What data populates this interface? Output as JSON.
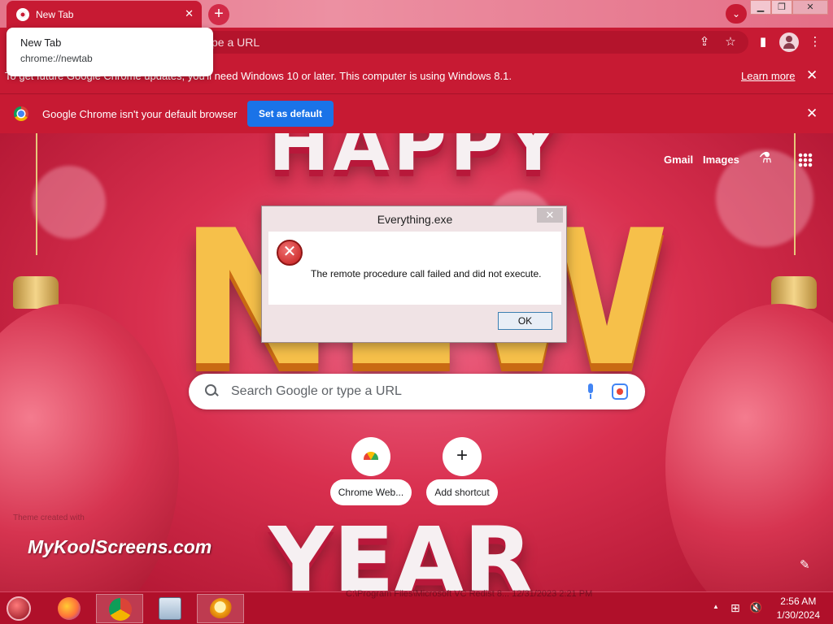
{
  "browser": {
    "tab": {
      "title": "New Tab",
      "close_glyph": "✕"
    },
    "new_tab_glyph": "+",
    "tab_search_glyph": "⌄",
    "window_buttons": {
      "minimize": "▁",
      "restore": "❐",
      "close": "✕"
    },
    "hover_card": {
      "title": "New Tab",
      "url": "chrome://newtab"
    },
    "omnibox": {
      "placeholder": "pe a URL"
    },
    "toolbar_icons": {
      "share": "⇪",
      "bookmark": "☆",
      "side_panel": "▮",
      "menu": "⋮"
    }
  },
  "infobars": {
    "update": {
      "message": "To get future Google Chrome updates, you'll need Windows 10 or later. This computer is using Windows 8.1.",
      "link": "Learn more",
      "close": "✕"
    },
    "default_browser": {
      "message": "Google Chrome isn't your default browser",
      "button": "Set as default",
      "close": "✕"
    }
  },
  "ntp": {
    "links": {
      "gmail": "Gmail",
      "images": "Images"
    },
    "search": {
      "placeholder": "Search Google or type a URL"
    },
    "shortcuts": [
      {
        "label": "Chrome Web...",
        "icon": "chrome-web-store-icon"
      },
      {
        "label": "Add shortcut",
        "icon": "plus-icon",
        "glyph": "+"
      }
    ],
    "edit_glyph": "✎",
    "background_faint_text": "Theme created with",
    "background_letters": {
      "top": "HAPPY",
      "middle": "NEW",
      "bottom": "YEAR"
    }
  },
  "dialog": {
    "title": "Everything.exe",
    "close_glyph": "✕",
    "error_glyph": "✕",
    "message": "The remote procedure call failed and did not execute.",
    "ok_label": "OK"
  },
  "watermark": "MyKoolScreens.com",
  "taskbar": {
    "apps": [
      "firefox-icon",
      "chrome-icon",
      "task-manager-icon",
      "everything-search-icon"
    ],
    "faint_text": "C:\\Program Files\\Microsoft VC Redist 8...   12/31/2023 2:21 PM",
    "tray": {
      "up_arrow": "▲",
      "network": "⊞",
      "volume": "🔇"
    },
    "clock": {
      "time": "2:56 AM",
      "date": "1/30/2024"
    }
  },
  "colors": {
    "chrome_red": "#c71a33",
    "accent_blue": "#1a73e8",
    "dialog_bg": "#f0e3e5"
  }
}
